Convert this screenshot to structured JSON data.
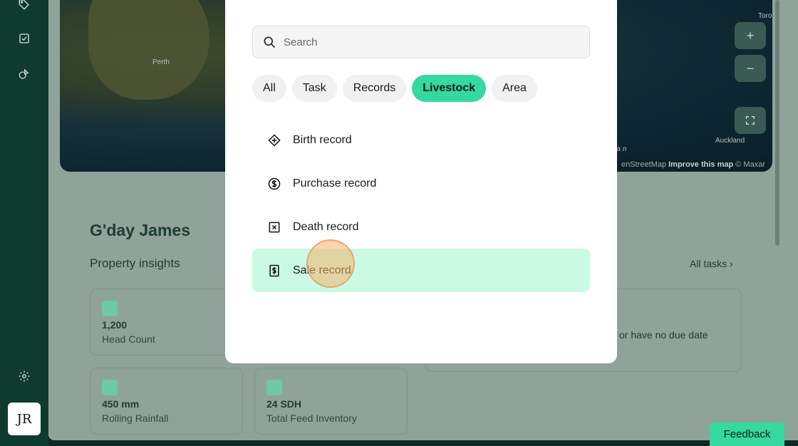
{
  "sidebar": {
    "icons": [
      "tag-icon",
      "checkbox-icon",
      "shapes-icon",
      "gear-icon"
    ],
    "avatar_initials": "JR"
  },
  "map": {
    "cities": [
      "Perth",
      "Auckland",
      "Toro"
    ],
    "ocean_label": "man",
    "zoom_in": "+",
    "zoom_out": "−",
    "attribution_prefix": "enStreetMap",
    "attribution_improve": "Improve this map",
    "attribution_suffix": "© Maxar"
  },
  "dashboard": {
    "greeting": "G'day James",
    "insights_title": "Property insights",
    "all_tasks": "All tasks",
    "cards": [
      {
        "value": "1,200",
        "label": "Head Count"
      },
      {
        "value": "450  mm",
        "label": "Rolling Rainfall"
      },
      {
        "value": "24  SDH",
        "label": "Total Feed Inventory"
      }
    ],
    "tasks_text": "or have no due date"
  },
  "modal": {
    "search_placeholder": "Search",
    "chips": [
      "All",
      "Task",
      "Records",
      "Livestock",
      "Area"
    ],
    "active_chip": "Livestock",
    "items": [
      {
        "label": "Birth record",
        "icon": "diamond-plus-icon"
      },
      {
        "label": "Purchase record",
        "icon": "dollar-circle-icon"
      },
      {
        "label": "Death record",
        "icon": "x-square-icon"
      },
      {
        "label": "Sale record",
        "icon": "dollar-receipt-icon"
      }
    ],
    "selected_item": "Sale record"
  },
  "feedback_label": "Feedback",
  "colors": {
    "accent": "#34d9a0",
    "selected_row": "#cafae3",
    "sidebar": "#0f3a2e"
  }
}
